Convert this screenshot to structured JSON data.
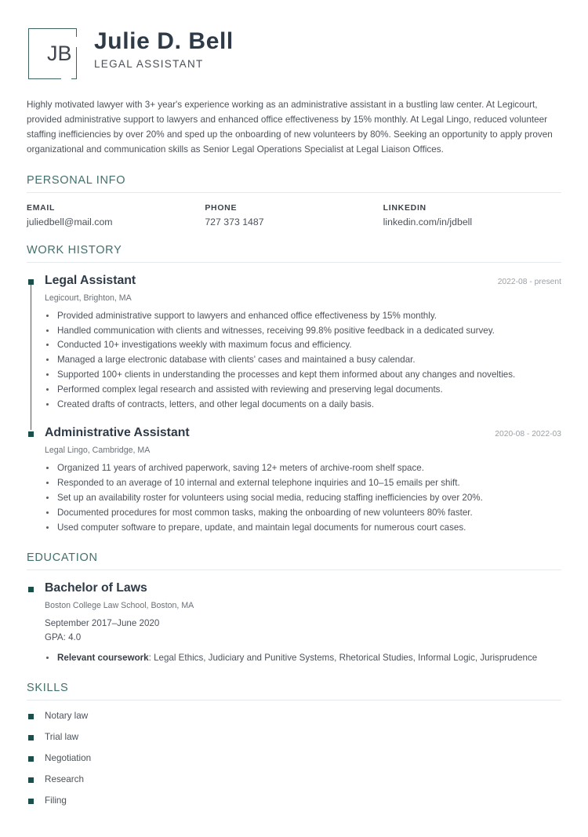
{
  "theme": {
    "accent_heading": "#43706c",
    "marker": "#1d4f4a",
    "name_color": "#2f3a47",
    "body_text": "#4c525a",
    "date_text": "#9aa0a6",
    "divider": "#e6eaec"
  },
  "header": {
    "monogram": "JB",
    "name": "Julie D. Bell",
    "role": "LEGAL ASSISTANT"
  },
  "summary": "Highly motivated lawyer with 3+ year's experience working as an administrative assistant in a bustling law center. At Legicourt, provided administrative support to lawyers and enhanced office effectiveness by 15% monthly. At Legal Lingo, reduced volunteer staffing inefficiencies by over 20% and sped up the onboarding of new volunteers by 80%. Seeking an opportunity to apply proven organizational and communication skills as Senior Legal Operations Specialist at Legal Liaison Offices.",
  "sections": {
    "personal_info": {
      "title": "PERSONAL INFO",
      "fields": [
        {
          "label": "EMAIL",
          "value": "juliedbell@mail.com"
        },
        {
          "label": "PHONE",
          "value": "727 373 1487"
        },
        {
          "label": "LINKEDIN",
          "value": "linkedin.com/in/jdbell"
        }
      ]
    },
    "work_history": {
      "title": "WORK HISTORY",
      "entries": [
        {
          "title": "Legal Assistant",
          "date": "2022-08  - present",
          "subtitle": "Legicourt, Brighton, MA",
          "bullets": [
            "Provided administrative support to lawyers and enhanced office effectiveness by 15% monthly.",
            "Handled communication with clients and witnesses, receiving 99.8% positive feedback in a dedicated survey.",
            "Conducted 10+ investigations weekly with maximum focus and efficiency.",
            "Managed a large electronic database with clients' cases and maintained a busy calendar.",
            "Supported 100+ clients in understanding the processes and kept them informed about any changes and novelties.",
            "Performed complex legal research and assisted with reviewing and preserving legal documents.",
            "Created drafts of contracts, letters, and other legal documents on a daily basis."
          ]
        },
        {
          "title": "Administrative Assistant",
          "date": "2020-08  - 2022-03",
          "subtitle": "Legal Lingo, Cambridge, MA",
          "bullets": [
            "Organized 11 years of archived paperwork, saving 12+ meters of archive-room shelf space.",
            "Responded to an average of 10 internal and external telephone inquiries and 10–15 emails per shift.",
            "Set up an availability roster for volunteers using social media, reducing staffing inefficiencies by over 20%.",
            "Documented procedures for most common tasks, making the onboarding of new volunteers 80% faster.",
            "Used computer software to prepare, update, and maintain legal documents for numerous court cases."
          ]
        }
      ]
    },
    "education": {
      "title": "EDUCATION",
      "entries": [
        {
          "title": "Bachelor of Laws",
          "subtitle": "Boston College Law School, Boston, MA",
          "dates": "September 2017–June 2020",
          "gpa": "GPA: 4.0",
          "coursework_label": "Relevant coursework",
          "coursework_value": ": Legal Ethics, Judiciary and Punitive Systems, Rhetorical Studies, Informal Logic, Jurisprudence"
        }
      ]
    },
    "skills": {
      "title": "SKILLS",
      "items": [
        "Notary law",
        "Trial law",
        "Negotiation",
        "Research",
        "Filing"
      ]
    }
  }
}
